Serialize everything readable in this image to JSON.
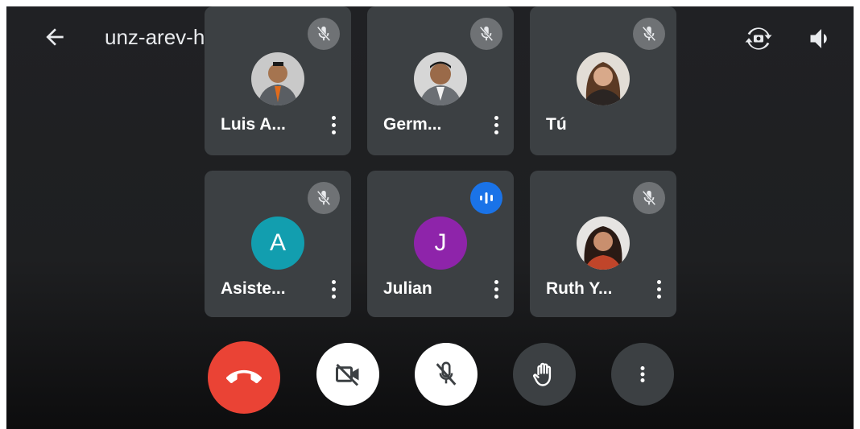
{
  "meeting": {
    "code": "unz-arev-hsm"
  },
  "participants": [
    {
      "name": "Luis A...",
      "avatar": "photo",
      "mic": "muted"
    },
    {
      "name": "Germ...",
      "avatar": "photo",
      "mic": "muted"
    },
    {
      "name": "Tú",
      "avatar": "photo",
      "mic": "muted"
    },
    {
      "name": "Asiste...",
      "initial": "A",
      "avatar_color": "#129eaf",
      "mic": "muted"
    },
    {
      "name": "Julian",
      "initial": "J",
      "avatar_color": "#8e24aa",
      "mic": "speaking"
    },
    {
      "name": "Ruth Y...",
      "avatar": "photo",
      "mic": "muted"
    }
  ],
  "colors": {
    "end_call": "#ea4335",
    "tile_bg": "#3c4043",
    "speaking": "#1a73e8",
    "muted_badge": "#6f7275"
  },
  "icons": {
    "back": "arrow-left-icon",
    "title_caret": "caret-right-icon",
    "switch_camera": "camera-switch-icon",
    "audio": "speaker-icon",
    "muted": "mic-off-icon",
    "speaking": "audio-wave-icon",
    "more": "more-vert-icon",
    "end_call": "call-end-icon",
    "camera_off": "videocam-off-icon",
    "mic_off": "mic-off-icon",
    "raise_hand": "hand-icon",
    "overflow": "more-vert-icon"
  }
}
